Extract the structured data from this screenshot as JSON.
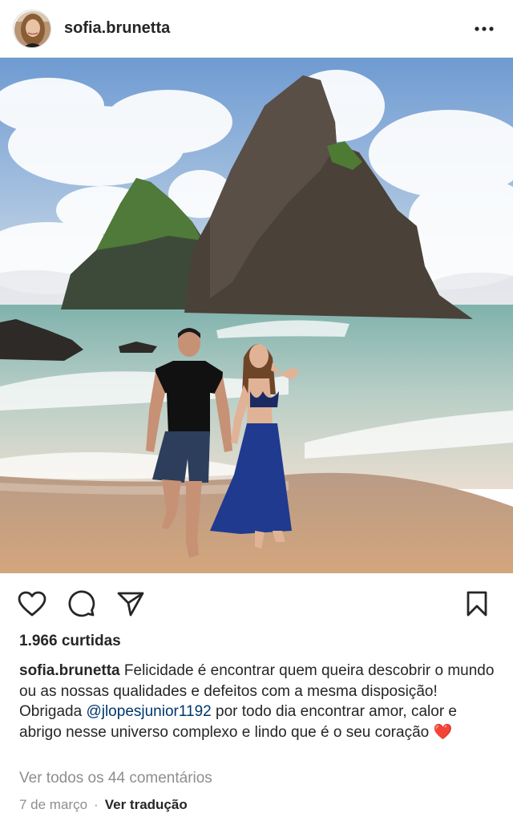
{
  "post": {
    "username": "sofia.brunetta",
    "likes_text": "1.966 curtidas",
    "caption": {
      "username": "sofia.brunetta",
      "text_before": "Felicidade é encontrar quem queira descobrir o mundo ou as nossas qualidades e defeitos com a mesma disposição! Obrigada",
      "mention": "@jlopesjunior1192",
      "text_after": "por todo dia encontrar amor, calor e abrigo nesse universo complexo e lindo que é o seu coração",
      "emoji": "❤️"
    },
    "view_comments": "Ver todos os 44 comentários",
    "date": "7 de março",
    "separator": "·",
    "translate": "Ver tradução"
  },
  "icons": {
    "more": "more-options-icon",
    "like": "heart-icon",
    "comment": "comment-icon",
    "share": "send-icon",
    "save": "bookmark-icon"
  },
  "colors": {
    "text": "#262626",
    "secondary": "#8e8e8e",
    "mention": "#00376b",
    "sky": "#7fa6d6",
    "sea": "#8fb9b3",
    "sand": "#c89c78",
    "dress": "#1f3a8f"
  }
}
